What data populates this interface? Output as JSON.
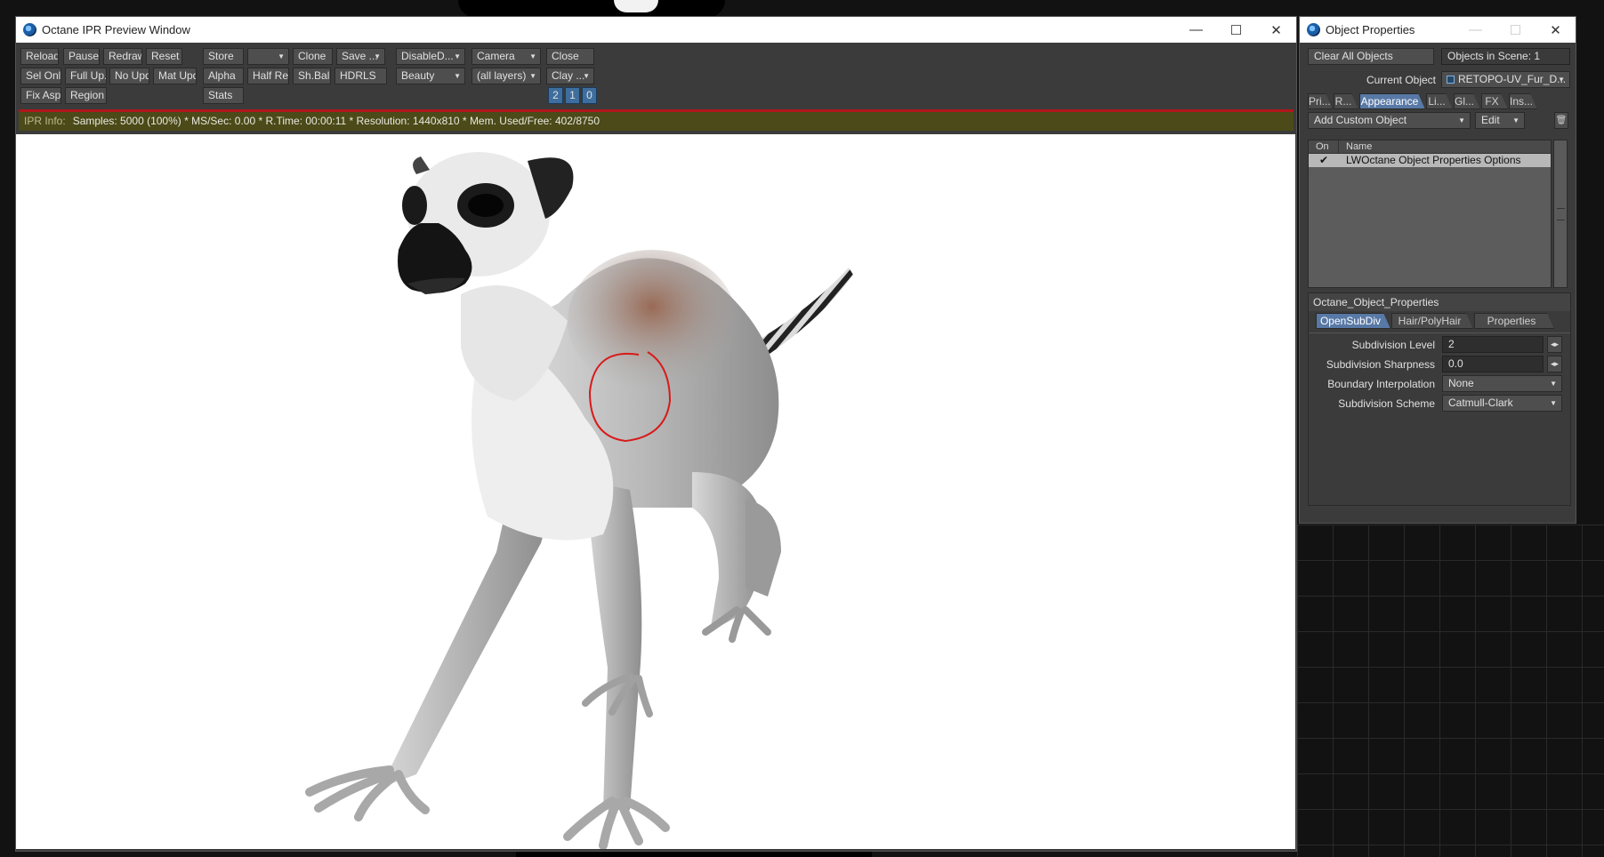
{
  "ipr_window": {
    "title": "Octane IPR Preview Window",
    "toolbar": {
      "reload": "Reload",
      "pause": "Pause",
      "redraw": "Redraw",
      "reset": "Reset",
      "store": "Store",
      "store_slot": "",
      "clone": "Clone",
      "save": "Save ...",
      "disable": "DisableD...",
      "camera": "Camera",
      "close": "Close",
      "sel_only": "Sel Only",
      "full_upd": "Full Up...",
      "no_upd": "No Upd.",
      "mat_upd": "Mat Upd",
      "alpha": "Alpha",
      "half_res": "Half Res",
      "sh_ball": "Sh.Ball",
      "hdrls": "HDRLS",
      "beauty": "Beauty",
      "all_layers": "(all layers)",
      "clay": "Clay ...",
      "fix_asp": "Fix Asp.",
      "region": "Region",
      "stats": "Stats",
      "num1": "2",
      "num2": "1",
      "num3": "0"
    },
    "info": {
      "label": "IPR Info:",
      "text": "Samples: 5000 (100%)  *  MS/Sec: 0.00  *  R.Time: 00:00:11  *  Resolution: 1440x810  *  Mem. Used/Free: 402/8750"
    }
  },
  "props_window": {
    "title": "Object Properties",
    "clear_all": "Clear All Objects",
    "objects_in_scene": "Objects in Scene: 1",
    "current_object_label": "Current Object",
    "current_object_value": "RETOPO-UV_Fur_D...",
    "tabs": [
      "Pri...",
      "R...",
      "Appearance",
      "Li...",
      "Gl...",
      "FX",
      "Ins..."
    ],
    "active_tab": "Appearance",
    "add_custom": "Add Custom Object",
    "edit": "Edit",
    "list": {
      "col_on": "On",
      "col_name": "Name",
      "rows": [
        {
          "on": "✔",
          "name": "LWOctane Object Properties Options"
        }
      ]
    },
    "section_title": "Octane_Object_Properties",
    "subtabs": [
      "OpenSubDiv",
      "Hair/PolyHair",
      "Properties"
    ],
    "fields": {
      "subdiv_level_label": "Subdivision Level",
      "subdiv_level_value": "2",
      "subdiv_sharp_label": "Subdivision Sharpness",
      "subdiv_sharp_value": "0.0",
      "boundary_label": "Boundary Interpolation",
      "boundary_value": "None",
      "scheme_label": "Subdivision Scheme",
      "scheme_value": "Catmull-Clark"
    }
  },
  "colors": {
    "accent_tab": "#5879a6",
    "info_bar": "#4b4a18",
    "render_line": "#b0161a",
    "annotation": "#d81a1a"
  }
}
